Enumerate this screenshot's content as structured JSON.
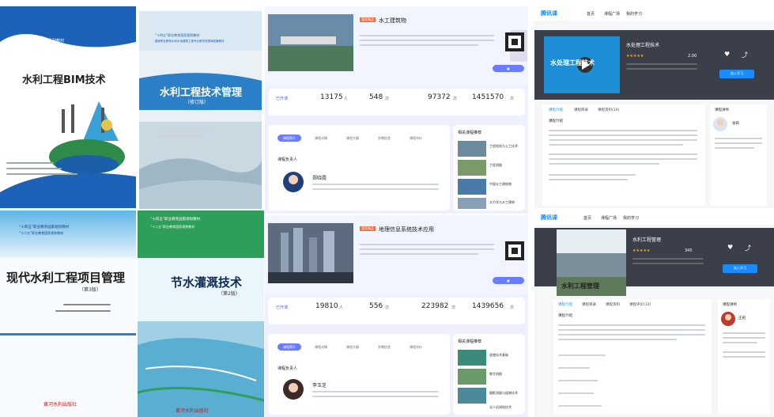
{
  "books": [
    {
      "title": "水利工程BIM技术",
      "series": "高等职业教育水利类专业系列教材"
    },
    {
      "title": "水利工程技术管理",
      "edition": "（修订版）",
      "badge": "“十四五”职业教育国家规划教材",
      "badge2": "国家职业教育水利水电建筑工程专业教学资源库配套教材"
    },
    {
      "title": "现代水利工程项目管理",
      "edition": "（第3版）",
      "badge": "“十四五”职业教育国家规划教材",
      "badge2": "“十二五”职业教育国家规划教材",
      "publisher": "黄河水利出版社"
    },
    {
      "title": "节水灌溉技术",
      "edition": "（第2版）",
      "badge": "“十四五”职业教育国家规划教材",
      "badge2": "“十二五”职业教育国家规划教材",
      "publisher": "黄河水利出版社"
    }
  ],
  "courses": [
    {
      "name": "水工建筑物",
      "tag": "国家精品",
      "stats": [
        {
          "value": "13175",
          "unit": "人"
        },
        {
          "value": "548",
          "unit": "次"
        },
        {
          "value": "97372",
          "unit": "次"
        },
        {
          "value": "1451570",
          "unit": "次"
        }
      ],
      "stat_label": "已开课",
      "tabs": [
        "课程简介",
        "课程详情",
        "课程大纲",
        "学期信息",
        "课程评价"
      ],
      "teacher_heading": "课程负责人",
      "teacher_name": "郑晓霞",
      "side_heading": "相关课程推荐",
      "side_items": [
        "工程地质与土工技术",
        "工程测量",
        "中国水工建筑物",
        "水力学与水工建筑"
      ]
    },
    {
      "name": "地理信息系统技术应用",
      "tag": "国家精品",
      "stats": [
        {
          "value": "19810",
          "unit": "人"
        },
        {
          "value": "556",
          "unit": "次"
        },
        {
          "value": "223982",
          "unit": "次"
        },
        {
          "value": "1439656",
          "unit": "次"
        }
      ],
      "stat_label": "已开课",
      "tabs": [
        "课程简介",
        "课程详情",
        "课程大纲",
        "学期信息",
        "课程评价"
      ],
      "teacher_heading": "课程负责人",
      "teacher_name": "李玉芝",
      "side_heading": "相关课程推荐",
      "side_items": [
        "遥感技术基础",
        "数字测图",
        "摄影测量与遥感技术",
        "无人机测绘技术"
      ]
    }
  ],
  "platforms": [
    {
      "logo": "腾讯课",
      "nav": [
        "首页",
        "课程广场",
        "我的学习"
      ],
      "course_title": "水处理工程技术",
      "video_label": "水处理工程技术",
      "rating": "★★★★★",
      "score": "2.00",
      "tabs": [
        "课程介绍",
        "课程目录",
        "课程资料(10)"
      ],
      "section": "课程介绍",
      "teacher_label": "课程讲师",
      "teacher_name": "张莉",
      "enroll_label": "加入学习"
    },
    {
      "logo": "腾讯课",
      "nav": [
        "首页",
        "课程广场",
        "我的学习"
      ],
      "course_title": "水利工程管理",
      "video_label": "水利工程管理",
      "rating": "★★★★★",
      "score": "345",
      "tabs": [
        "课程介绍",
        "课程目录",
        "课程资料",
        "课程评价(12)"
      ],
      "section": "课程介绍",
      "teacher_label": "课程讲师",
      "teacher_name": "王莉",
      "enroll_label": "加入学习"
    }
  ],
  "colors": {
    "accent": "#4a6cf7",
    "book_blue": "#1f5fb0",
    "green": "#2e9e5b"
  }
}
